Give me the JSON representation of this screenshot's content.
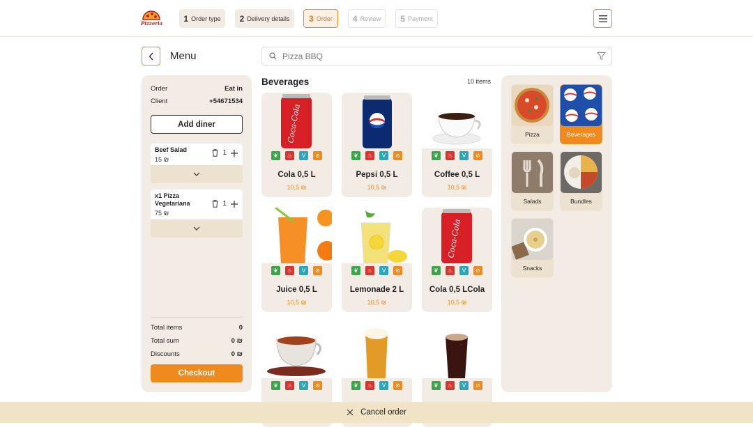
{
  "logo": {
    "text": "Pizzeria"
  },
  "steps": [
    {
      "num": "1",
      "label": "Order type",
      "state": "done"
    },
    {
      "num": "2",
      "label": "Delivery details",
      "state": "done"
    },
    {
      "num": "3",
      "label": "Order",
      "state": "active"
    },
    {
      "num": "4",
      "label": "Review",
      "state": "pending"
    },
    {
      "num": "5",
      "label": "Payment",
      "state": "pending"
    }
  ],
  "page": {
    "title": "Menu"
  },
  "search": {
    "placeholder": "Pizza BBQ"
  },
  "order": {
    "order_label": "Order",
    "order_value": "Eat in",
    "client_label": "Client",
    "client_value": "+54671534",
    "add_diner_label": "Add diner",
    "items": [
      {
        "name": "Beef Salad",
        "price": "15 ₪",
        "qty": "1"
      },
      {
        "name": "x1 Pizza Vegetariana",
        "price": "75 ₪",
        "qty": "1"
      }
    ],
    "total_items_label": "Total items",
    "total_items_value": "0",
    "total_sum_label": "Total sum",
    "total_sum_value": "0 ₪",
    "discounts_label": "Discounts",
    "discounts_value": "0 ₪",
    "checkout_label": "Checkout"
  },
  "section": {
    "title": "Beverages",
    "count": "10 items"
  },
  "products": [
    {
      "name": "Cola 0,5 L",
      "price": "10,5 ₪",
      "image": "cola-can"
    },
    {
      "name": "Pepsi 0,5 L",
      "price": "10,5 ₪",
      "image": "pepsi-can"
    },
    {
      "name": "Coffee 0,5 L",
      "price": "10,5 ₪",
      "image": "coffee-cup"
    },
    {
      "name": "Juice 0,5 L",
      "price": "10,5 ₪",
      "image": "orange-juice"
    },
    {
      "name": "Lemonade 2 L",
      "price": "10,5 ₪",
      "image": "lemonade"
    },
    {
      "name": "Cola 0,5 LCola",
      "price": "10,5 ₪",
      "image": "cola-can"
    },
    {
      "name": "",
      "price": "",
      "image": "tea-cup"
    },
    {
      "name": "",
      "price": "",
      "image": "light-beer"
    },
    {
      "name": "",
      "price": "",
      "image": "dark-beer"
    }
  ],
  "categories": [
    {
      "label": "Pizza",
      "selected": false
    },
    {
      "label": "Beverages",
      "selected": true
    },
    {
      "label": "Salads",
      "selected": false
    },
    {
      "label": "Bundles",
      "selected": false
    },
    {
      "label": "Snacks",
      "selected": false
    }
  ],
  "footer": {
    "cancel_label": "Cancel order"
  },
  "colors": {
    "accent": "#ef8a1f",
    "panel": "#f3ece4",
    "footer": "#f0e3c6"
  }
}
